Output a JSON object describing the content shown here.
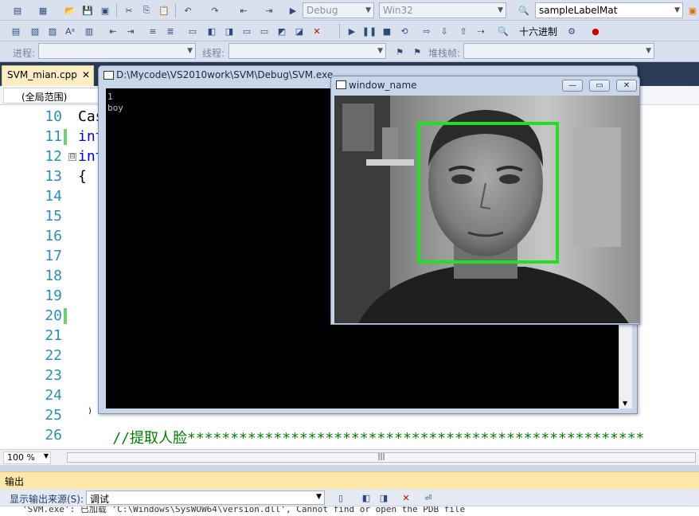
{
  "toolbar": {
    "config": "Debug",
    "platform": "Win32",
    "find_value": "sampleLabelMat",
    "hex_label": "十六进制",
    "process_label": "进程:",
    "thread_label": "线程:",
    "stack_label": "堆栈帧:"
  },
  "tab": {
    "label": "SVM_mian.cpp",
    "close": "✕"
  },
  "scope": {
    "value": "(全局范围)"
  },
  "editor": {
    "line_numbers": [
      "10",
      "11",
      "12",
      "13",
      "14",
      "15",
      "16",
      "17",
      "18",
      "19",
      "20",
      "21",
      "22",
      "23",
      "24",
      "25",
      "26"
    ],
    "code_lines": {
      "l10": "Cas",
      "l11": "int",
      "l12": "int",
      "l13": "{",
      "l25": "  )",
      "l26": "    //提取人脸*****************************************************"
    },
    "fold_symbol": "⊟"
  },
  "console": {
    "title": "D:\\Mycode\\VS2010work\\SVM\\Debug\\SVM.exe",
    "lines": [
      "1",
      "boy"
    ]
  },
  "image_window": {
    "title": "window_name",
    "minimize": "—",
    "maximize": "▭",
    "close": "✕"
  },
  "statusbar": {
    "zoom": "100 %",
    "scroll_grip": "|||"
  },
  "output": {
    "title": "输出",
    "source_label": "显示输出来源(S):",
    "source_value": "调试",
    "text": "'SVM.exe': 已加载 'C:\\Windows\\SysWOW64\\version.dll', Cannot find or open the PDB file"
  },
  "colors": {
    "detection_box": "#22e01f",
    "line_number": "#2b91af",
    "comment": "#008000",
    "change_marker": "#6fcf7a"
  }
}
